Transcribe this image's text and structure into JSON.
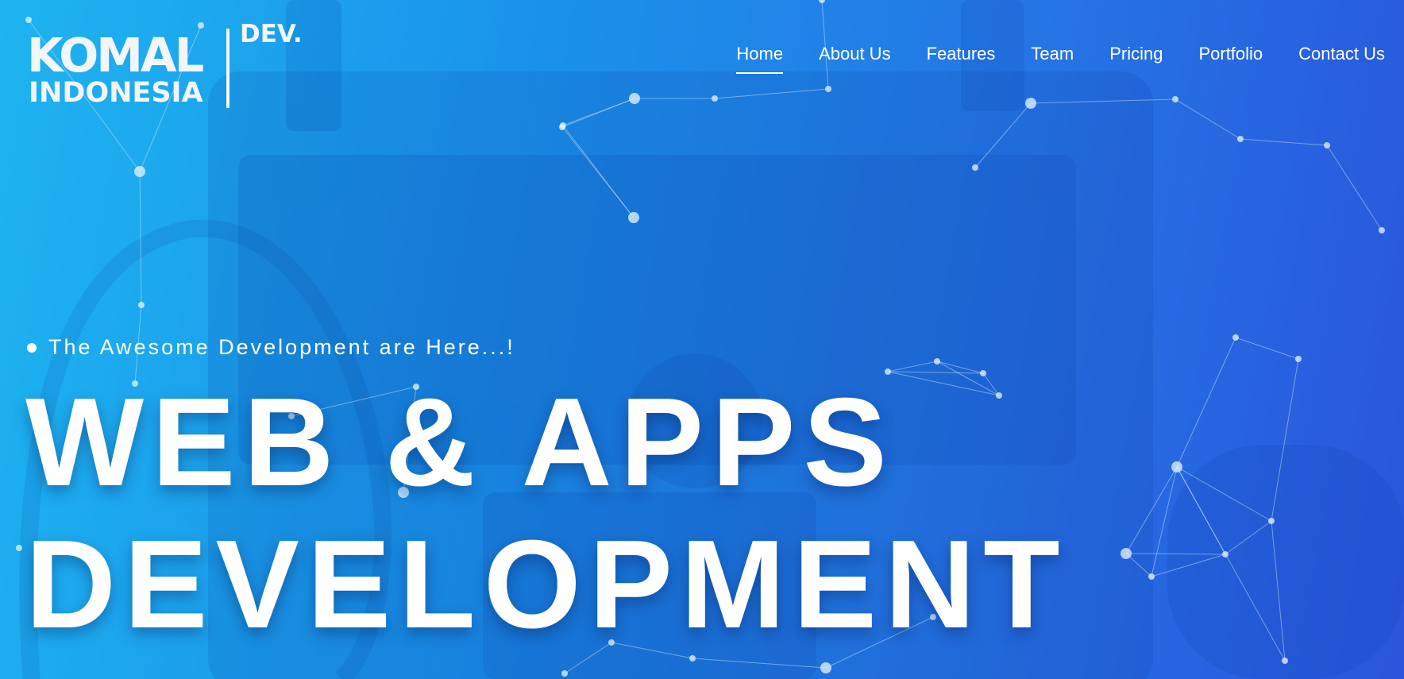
{
  "logo": {
    "line1": "KOMAL",
    "line2": "INDONESIA",
    "suffix": "DEV."
  },
  "nav": {
    "items": [
      {
        "label": "Home",
        "active": true
      },
      {
        "label": "About Us",
        "active": false
      },
      {
        "label": "Features",
        "active": false
      },
      {
        "label": "Team",
        "active": false
      },
      {
        "label": "Pricing",
        "active": false
      },
      {
        "label": "Portfolio",
        "active": false
      },
      {
        "label": "Contact Us",
        "active": false
      }
    ]
  },
  "hero": {
    "tagline": "The Awesome Development are Here...!",
    "headline_line1": "WEB & APPS",
    "headline_line2": "DEVELOPMENT"
  },
  "colors": {
    "gradient_start": "#1eb4f0",
    "gradient_end": "#2a55dc",
    "text": "#ffffff"
  }
}
